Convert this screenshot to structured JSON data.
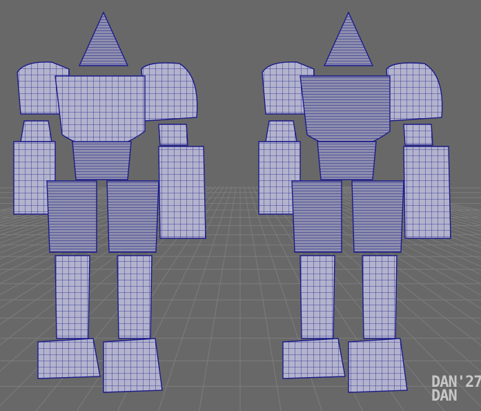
{
  "scene": {
    "description_free": true,
    "colors": {
      "background": "#686868",
      "grid": "#7d7d7d",
      "surface": "#b3b3cd",
      "surface_dark": "#8f8fae",
      "wire": "#1a1a8a"
    },
    "views": [
      "front-view",
      "back-view"
    ]
  },
  "watermark": {
    "line1": "DAN'27",
    "line2": "DAN"
  }
}
